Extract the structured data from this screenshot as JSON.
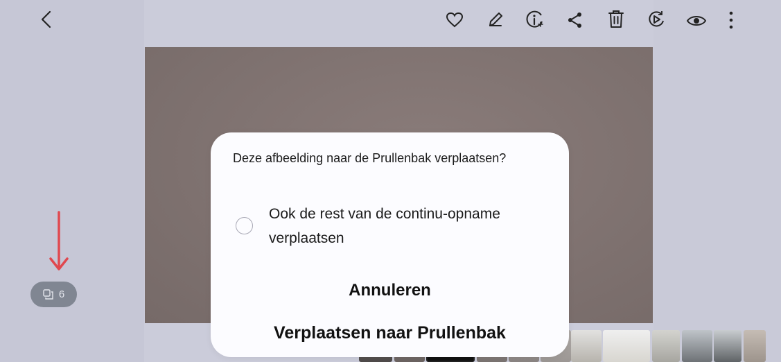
{
  "toolbar": {
    "back_icon": "chevron-left-icon",
    "actions": [
      "heart-icon",
      "pencil-icon",
      "info-icon",
      "share-icon",
      "trash-icon",
      "remaster-icon",
      "eye-icon",
      "more-vertical-icon"
    ]
  },
  "burst": {
    "count": "6",
    "icon": "burst-stack-icon"
  },
  "annotation": {
    "color": "#e0484f"
  },
  "dialog": {
    "title": "Deze afbeelding naar de Prullenbak verplaatsen?",
    "option_label": "Ook de rest van de continu-opname verplaatsen",
    "option_checked": false,
    "cancel_label": "Annuleren",
    "confirm_label": "Verplaatsen naar Prullenbak"
  },
  "colors": {
    "background": "#c9cad9",
    "dialog_bg": "#fcfcff",
    "photo": "#7f7270",
    "badge": "#808692"
  }
}
